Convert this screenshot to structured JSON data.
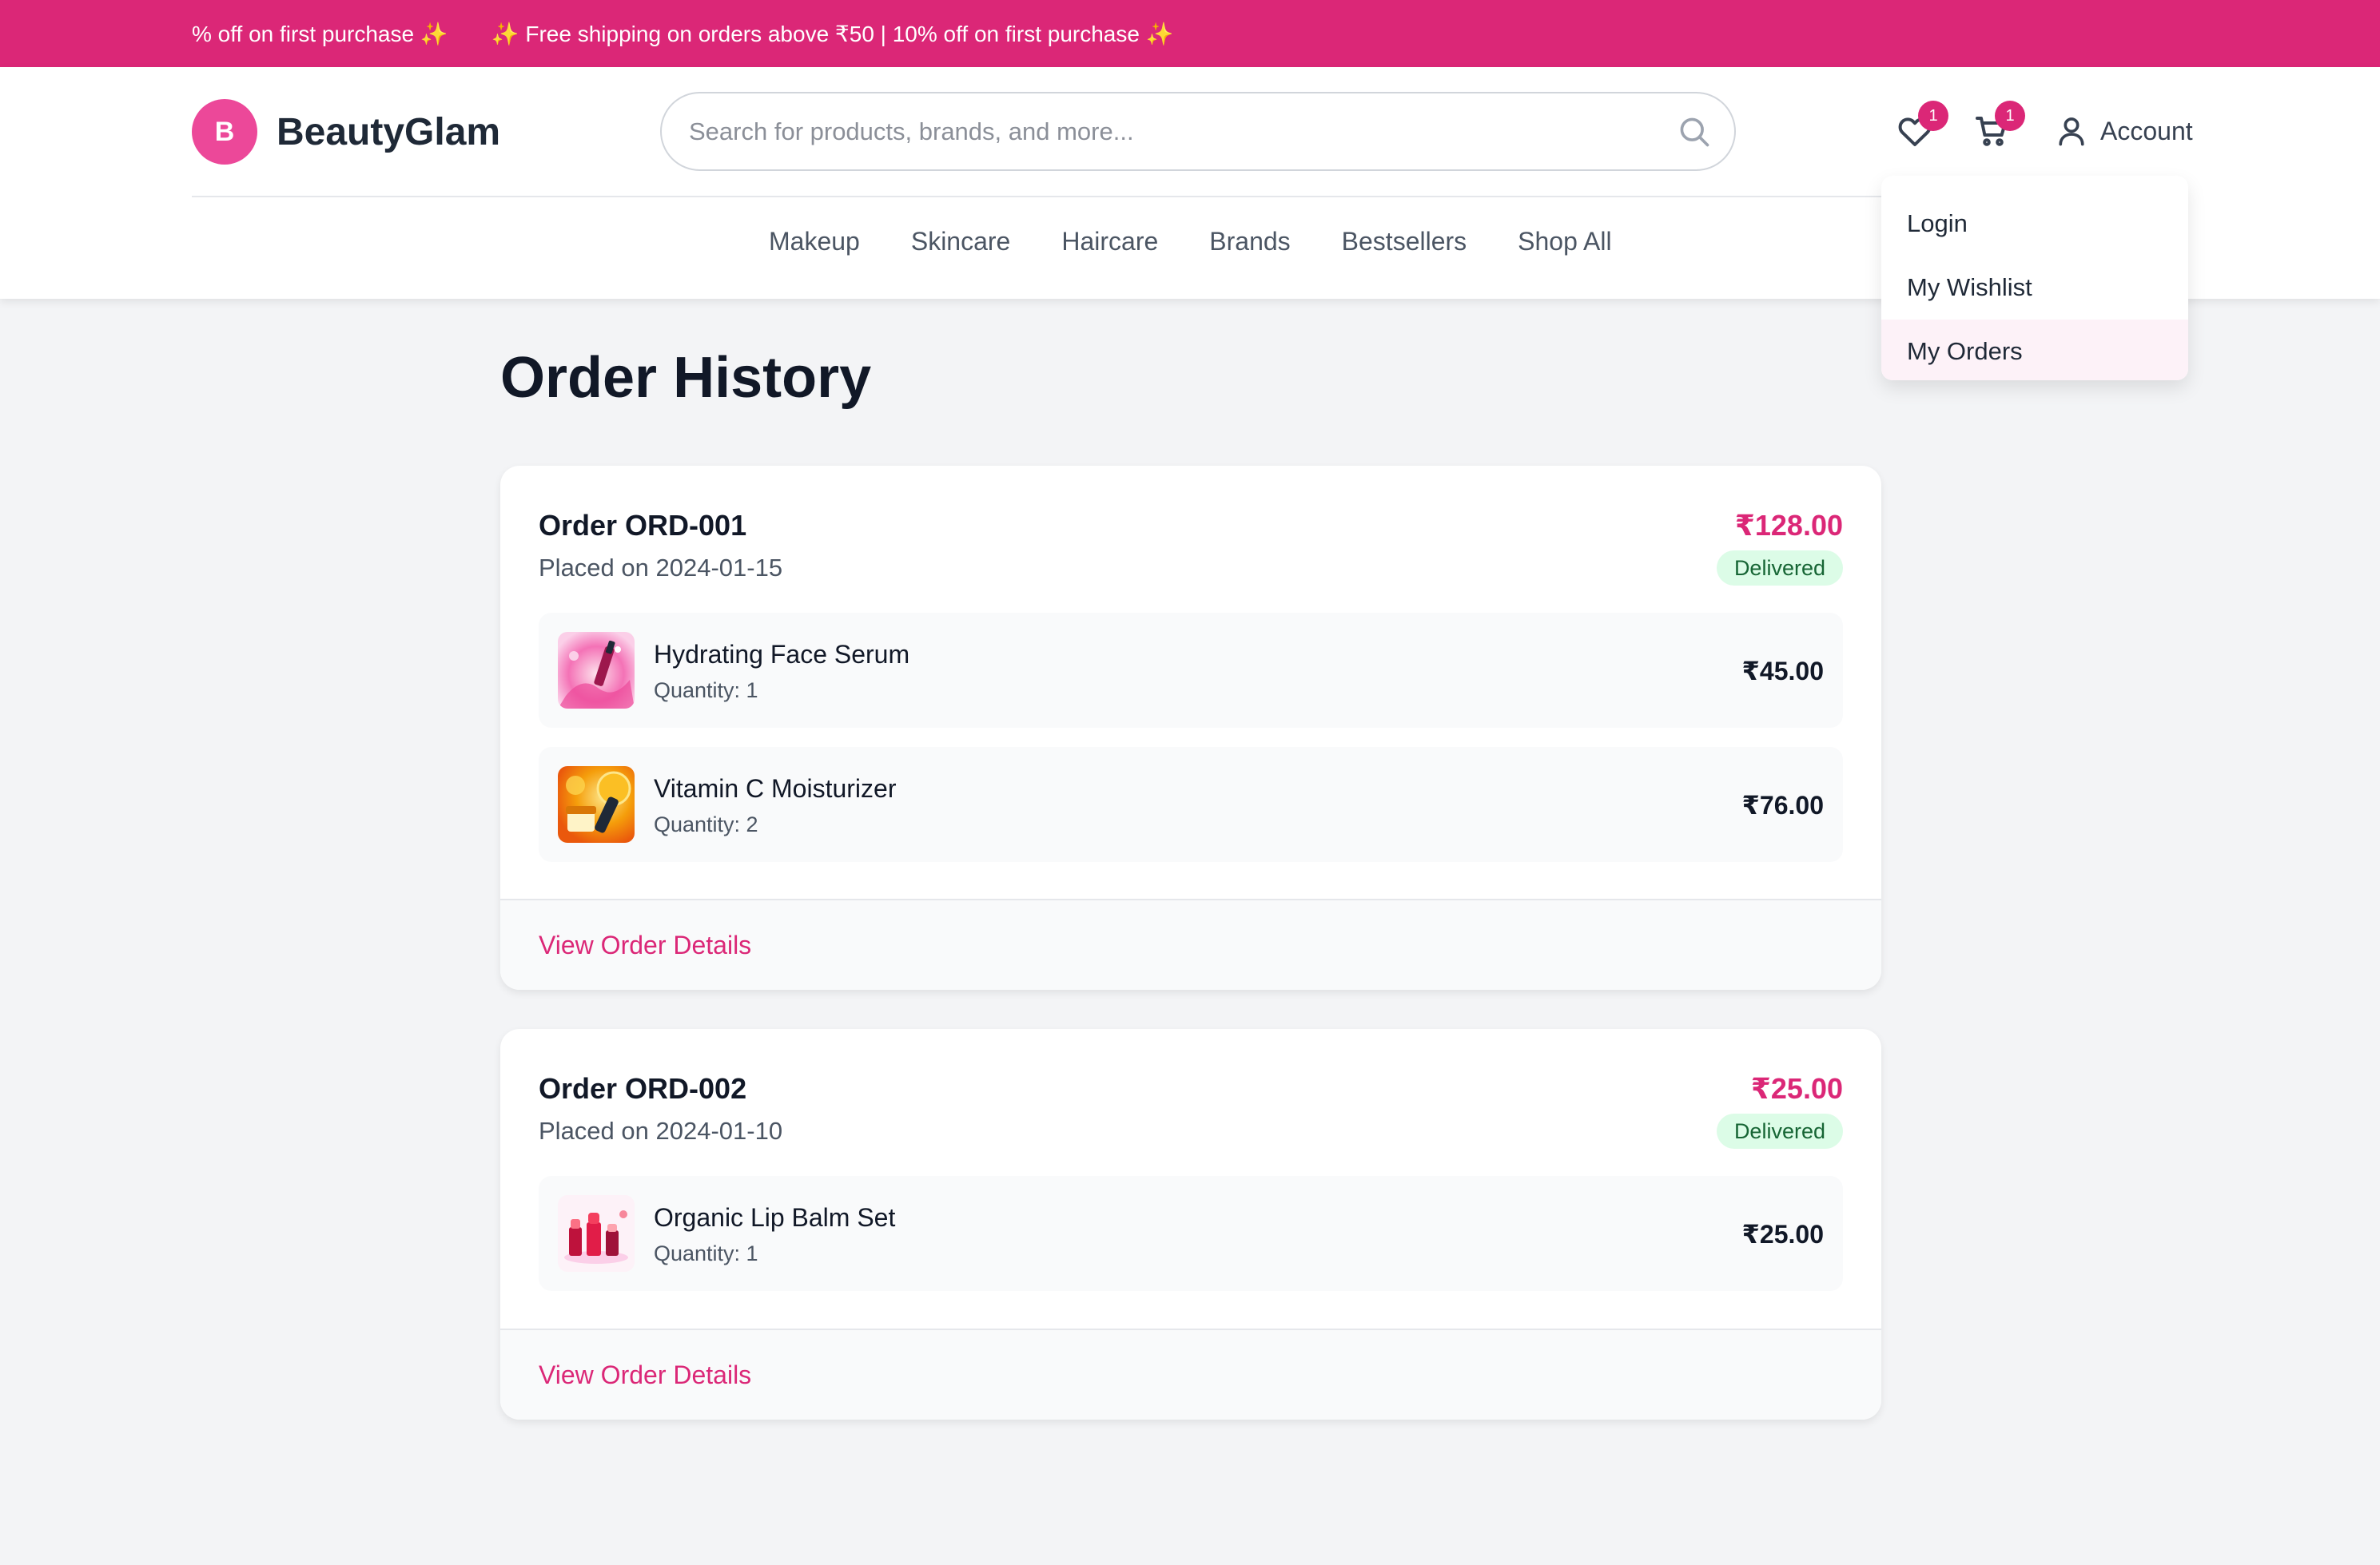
{
  "promo": {
    "messages": [
      "% off on first purchase ✨",
      "✨ Free shipping on orders above ₹50 | 10% off on first purchase ✨"
    ]
  },
  "brand": {
    "initial": "B",
    "name": "BeautyGlam",
    "accent": "#db2777"
  },
  "search": {
    "placeholder": "Search for products, brands, and more...",
    "value": ""
  },
  "header": {
    "wishlist_count": "1",
    "cart_count": "1",
    "account_label": "Account"
  },
  "nav": {
    "items": [
      "Makeup",
      "Skincare",
      "Haircare",
      "Brands",
      "Bestsellers",
      "Shop All"
    ]
  },
  "account_menu": {
    "items": [
      "Login",
      "My Wishlist",
      "My Orders"
    ],
    "active": "My Orders"
  },
  "page": {
    "title": "Order History"
  },
  "orders": [
    {
      "id_label": "Order ORD-001",
      "placed": "Placed on 2024-01-15",
      "total": "₹128.00",
      "status": "Delivered",
      "items": [
        {
          "name": "Hydrating Face Serum",
          "qty": "Quantity: 1",
          "price": "₹45.00",
          "thumb": "serum-image"
        },
        {
          "name": "Vitamin C Moisturizer",
          "qty": "Quantity: 2",
          "price": "₹76.00",
          "thumb": "moisturizer-image"
        }
      ],
      "details_link": "View Order Details"
    },
    {
      "id_label": "Order ORD-002",
      "placed": "Placed on 2024-01-10",
      "total": "₹25.00",
      "status": "Delivered",
      "items": [
        {
          "name": "Organic Lip Balm Set",
          "qty": "Quantity: 1",
          "price": "₹25.00",
          "thumb": "lip-balm-image"
        }
      ],
      "details_link": "View Order Details"
    }
  ]
}
